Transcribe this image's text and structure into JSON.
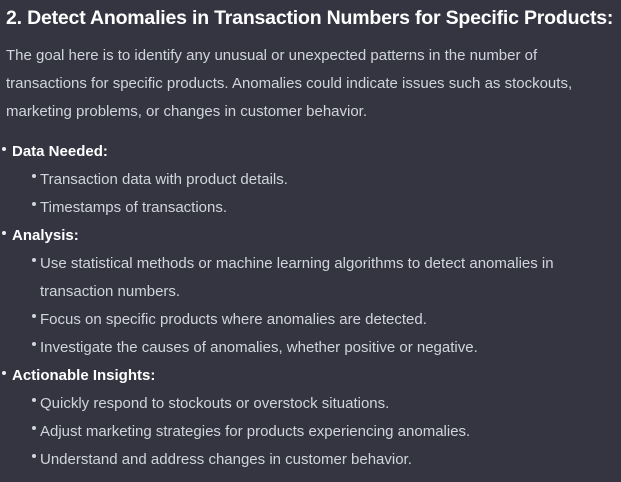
{
  "heading": "2. Detect Anomalies in Transaction Numbers for Specific Products:",
  "intro": "The goal here is to identify any unusual or unexpected patterns in the number of transactions for specific products. Anomalies could indicate issues such as stockouts, marketing problems, or changes in customer behavior.",
  "sections": [
    {
      "title": "Data Needed:",
      "items": [
        "Transaction data with product details.",
        "Timestamps of transactions."
      ]
    },
    {
      "title": "Analysis:",
      "items": [
        "Use statistical methods or machine learning algorithms to detect anomalies in transaction numbers.",
        "Focus on specific products where anomalies are detected.",
        "Investigate the causes of anomalies, whether positive or negative."
      ]
    },
    {
      "title": "Actionable Insights:",
      "items": [
        "Quickly respond to stockouts or overstock situations.",
        "Adjust marketing strategies for products experiencing anomalies.",
        "Understand and address changes in customer behavior."
      ]
    }
  ]
}
